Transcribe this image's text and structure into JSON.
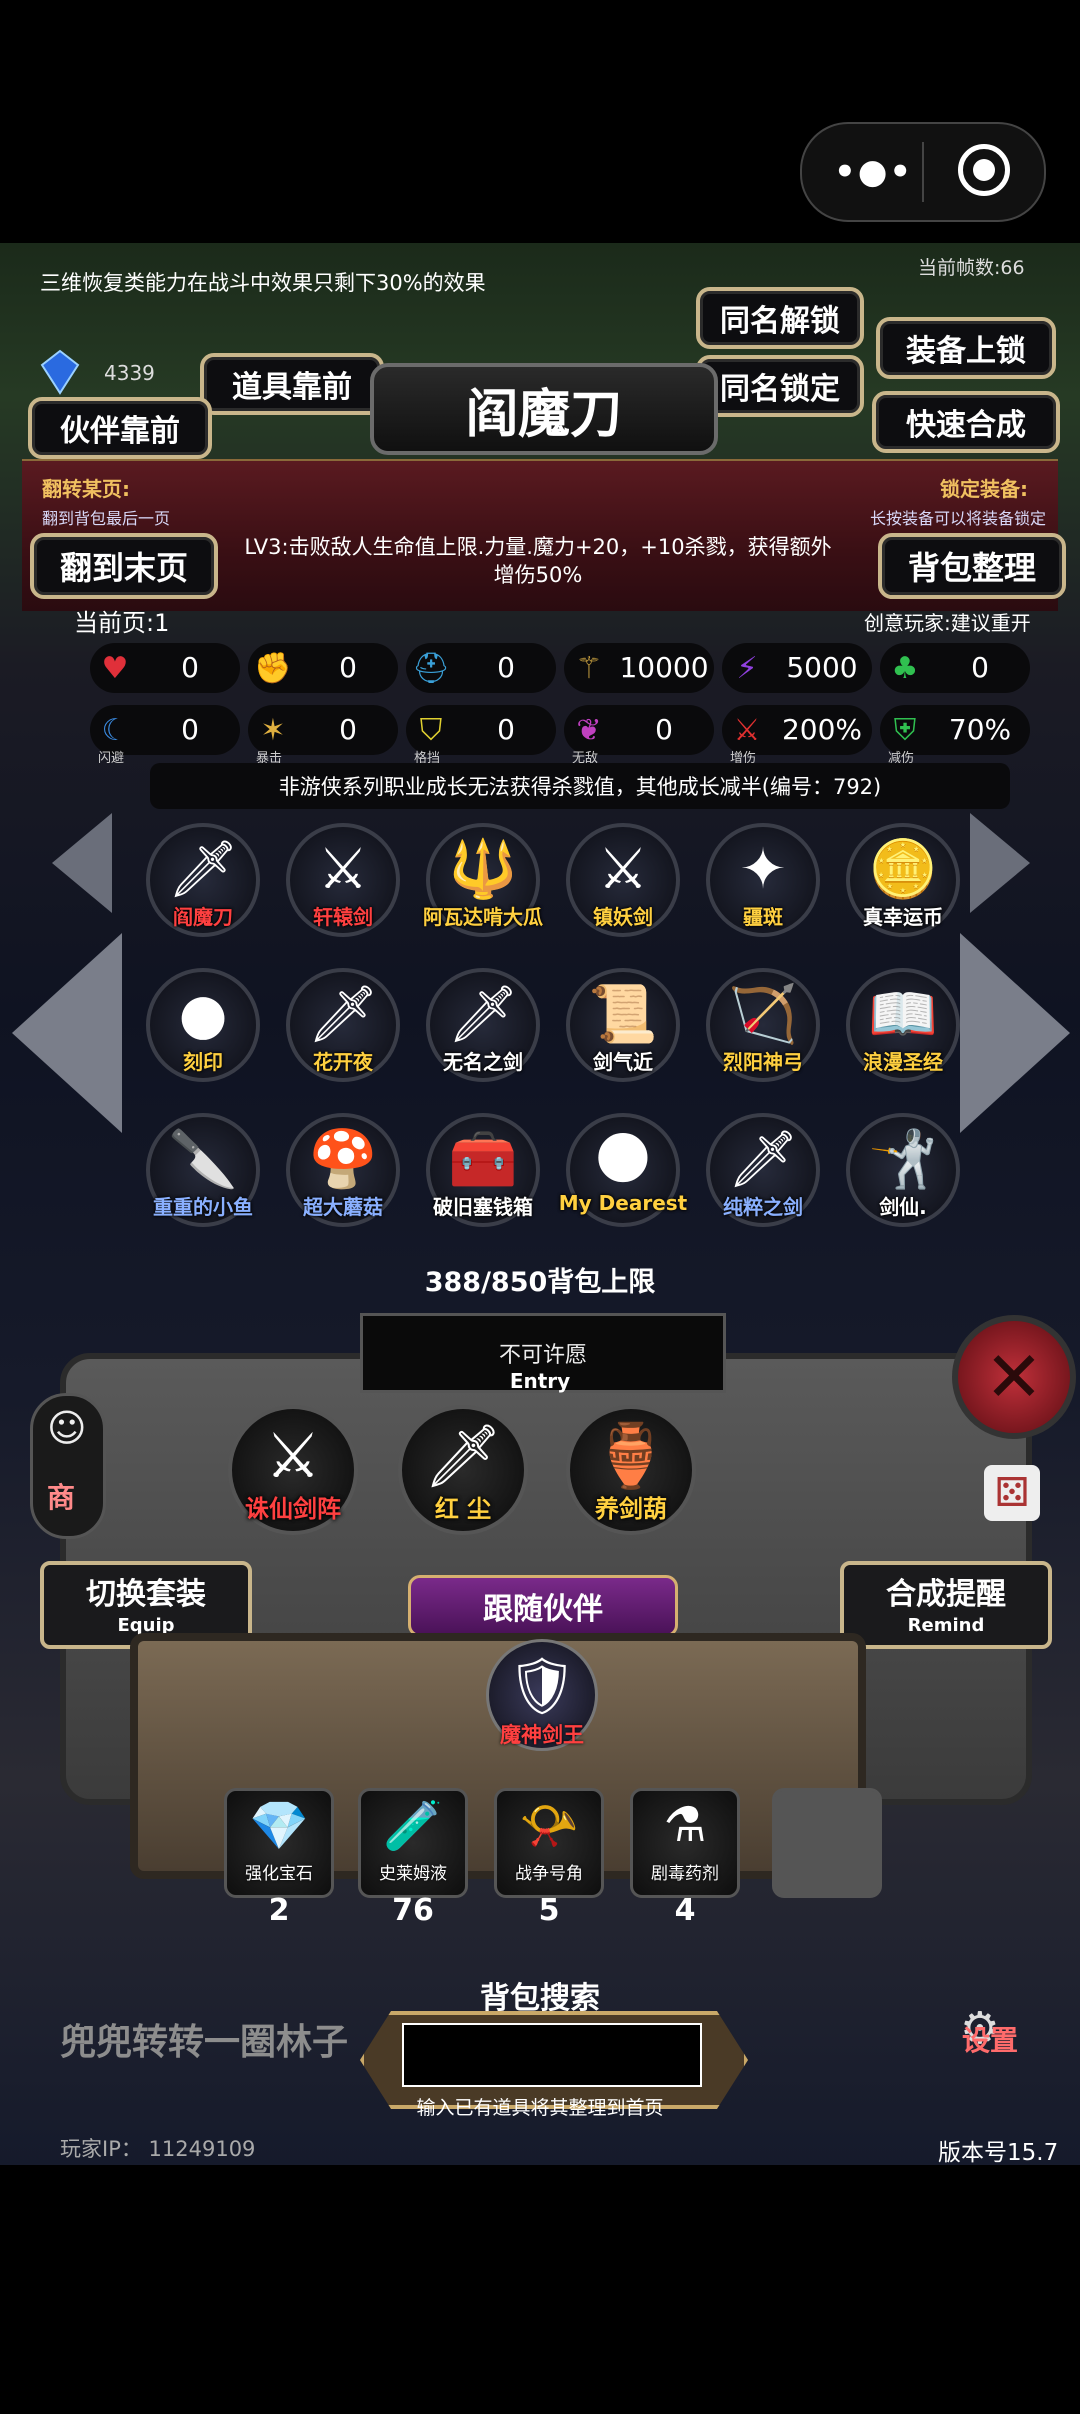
{
  "system_bar": {
    "more_icon": "more-dots-icon",
    "record_icon": "record-target-icon"
  },
  "notice_top": "三维恢复类能力在战斗中效果只剩下30%的效果",
  "fps_label": "当前帧数:66",
  "gem_count": "4339",
  "buttons": {
    "items_first": "道具靠前",
    "partner_first": "伙伴靠前",
    "same_name_unlock": "同名解锁",
    "same_name_lock": "同名锁定",
    "equip_lock": "装备上锁",
    "quick_combine": "快速合成",
    "go_last_page": "翻到末页",
    "bag_sort": "背包整理",
    "switch_set": "切换套装",
    "switch_set_sub": "Equip",
    "combine_remind": "合成提醒",
    "combine_remind_sub": "Remind",
    "follow_partner": "跟随伙伴",
    "shop": "商",
    "settings": "设置"
  },
  "selected_item": {
    "name": "阎魔刀",
    "description": "LV3:击败敌人生命值上限.力量.魔力+20，+10杀戮，获得额外增伤50%"
  },
  "flip_page": {
    "title": "翻转某页:",
    "desc": "翻到背包最后一页"
  },
  "lock_equip": {
    "title": "锁定装备:",
    "desc": "长按装备可以将装备锁定"
  },
  "current_page": "当前页:1",
  "creative_player": "创意玩家:建议重开",
  "stats_row1": [
    {
      "icon": "heart-icon",
      "value": "0",
      "color": "#e0303a"
    },
    {
      "icon": "strength-icon",
      "value": "0",
      "color": "#d8c030"
    },
    {
      "icon": "helmet-icon",
      "value": "0",
      "color": "#3aa0d8"
    },
    {
      "icon": "staff-icon",
      "value": "10000",
      "color": "#c8a040"
    },
    {
      "icon": "lightning-icon",
      "value": "5000",
      "color": "#9040e0"
    },
    {
      "icon": "clover-icon",
      "value": "0",
      "color": "#30c050"
    }
  ],
  "stats_row2": [
    {
      "icon": "dodge-icon",
      "value": "0",
      "sub": "闪避",
      "color": "#3a8ae0"
    },
    {
      "icon": "crit-icon",
      "value": "0",
      "sub": "暴击",
      "color": "#e0b040"
    },
    {
      "icon": "block-shield-icon",
      "value": "0",
      "sub": "格挡",
      "color": "#e0d030"
    },
    {
      "icon": "invincible-wings-icon",
      "value": "0",
      "sub": "无敌",
      "color": "#c040c0"
    },
    {
      "icon": "crossed-swords-icon",
      "value": "200%",
      "sub": "增伤",
      "color": "#e03030"
    },
    {
      "icon": "reduce-shield-icon",
      "value": "70%",
      "sub": "减伤",
      "color": "#30c050"
    }
  ],
  "notice_growth": "非游侠系列职业成长无法获得杀戮值，其他成长减半(编号：792)",
  "bag_items": [
    {
      "name": "阎魔刀",
      "glyph": "🗡",
      "color": "#ff4040"
    },
    {
      "name": "轩辕剑",
      "glyph": "⚔",
      "color": "#ff4040"
    },
    {
      "name": "阿瓦达啃大瓜",
      "glyph": "🔱",
      "color": "#ffd040"
    },
    {
      "name": "镇妖剑",
      "glyph": "⚔",
      "color": "#ffd040"
    },
    {
      "name": "疆斑",
      "glyph": "✦",
      "color": "#ffd040"
    },
    {
      "name": "真幸运币",
      "glyph": "🪙",
      "color": "#ffffff"
    },
    {
      "name": "刻印",
      "glyph": "●",
      "color": "#ffd040"
    },
    {
      "name": "花开夜",
      "glyph": "🗡",
      "color": "#ffd040"
    },
    {
      "name": "无名之剑",
      "glyph": "🗡",
      "color": "#ffffff"
    },
    {
      "name": "剑气近",
      "glyph": "📜",
      "color": "#ffffff"
    },
    {
      "name": "烈阳神弓",
      "glyph": "🏹",
      "color": "#ffd040"
    },
    {
      "name": "浪漫圣经",
      "glyph": "📖",
      "color": "#ffd040"
    },
    {
      "name": "重重的小鱼",
      "glyph": "🔪",
      "color": "#8ab0ff"
    },
    {
      "name": "超大蘑菇",
      "glyph": "🍄",
      "color": "#8ab0ff"
    },
    {
      "name": "破旧塞钱箱",
      "glyph": "🧰",
      "color": "#ffffff"
    },
    {
      "name": "My Dearest",
      "glyph": "🌑",
      "color": "#ffd040"
    },
    {
      "name": "纯粹之剑",
      "glyph": "🗡",
      "color": "#8ab0ff"
    },
    {
      "name": "剑仙.",
      "glyph": "🤺",
      "color": "#ffffff"
    }
  ],
  "bag_capacity": "388/850背包上限",
  "wish": {
    "text": "不可许愿",
    "sub": "Entry"
  },
  "equipped": [
    {
      "name": "诛仙剑阵",
      "glyph": "⚔",
      "color": "#ff4040"
    },
    {
      "name": "红 尘",
      "glyph": "🗡",
      "color": "#ffd040"
    },
    {
      "name": "养剑葫",
      "glyph": "🏺",
      "color": "#ffd040"
    }
  ],
  "partner": {
    "name": "魔神剑王",
    "glyph": "🛡"
  },
  "consumables": [
    {
      "name": "强化宝石",
      "glyph": "💎",
      "count": "2"
    },
    {
      "name": "史莱姆液",
      "glyph": "🧪",
      "count": "76"
    },
    {
      "name": "战争号角",
      "glyph": "📯",
      "count": "5"
    },
    {
      "name": "剧毒药剂",
      "glyph": "⚗",
      "count": "4"
    },
    {
      "name": "",
      "glyph": "",
      "count": ""
    }
  ],
  "search": {
    "title": "背包搜索",
    "placeholder": "",
    "hint": "输入已有道具将其整理到首页"
  },
  "scroller_text": "兜兜转转一圈林子",
  "player_ip": "玩家IP：  11249109",
  "version": "版本号15.7"
}
